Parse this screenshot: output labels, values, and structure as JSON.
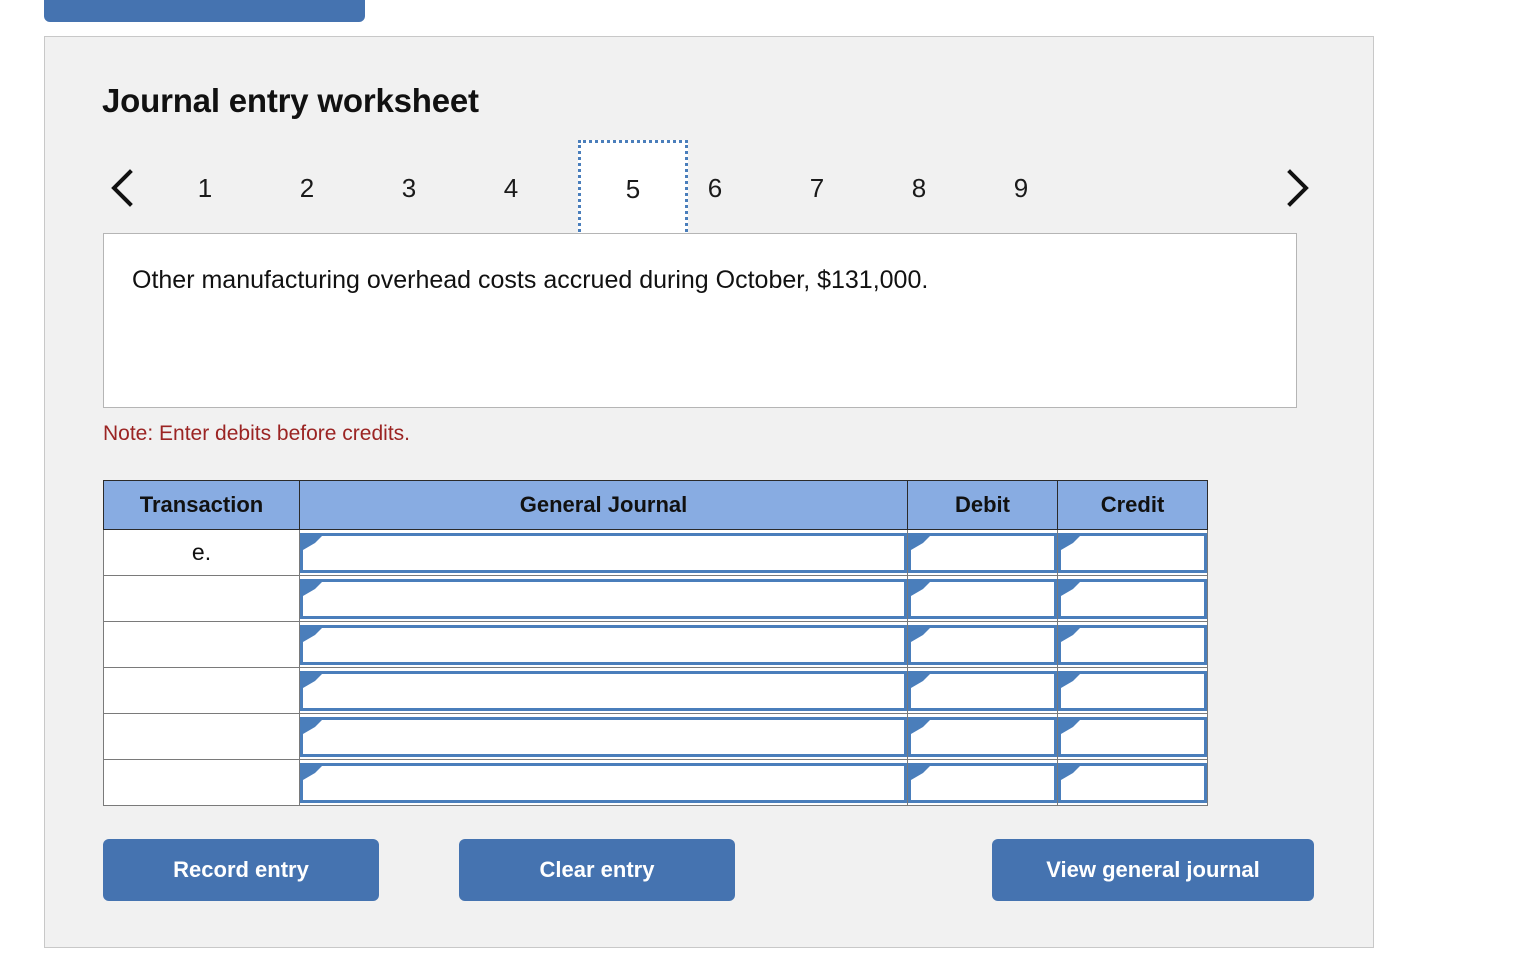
{
  "top_tab": {
    "label": ""
  },
  "panel": {
    "title": "Journal entry worksheet"
  },
  "pager": {
    "prev_icon": "chevron-left-icon",
    "next_icon": "chevron-right-icon",
    "pages": [
      "1",
      "2",
      "3",
      "4",
      "5",
      "6",
      "7",
      "8",
      "9"
    ],
    "active_page": "5"
  },
  "instruction": {
    "text": "Other manufacturing overhead costs accrued during October, $131,000."
  },
  "note": {
    "text": "Note: Enter debits before credits."
  },
  "table": {
    "headers": {
      "transaction": "Transaction",
      "general_journal": "General Journal",
      "debit": "Debit",
      "credit": "Credit"
    },
    "rows": [
      {
        "transaction": "e.",
        "general_journal": "",
        "debit": "",
        "credit": ""
      },
      {
        "transaction": "",
        "general_journal": "",
        "debit": "",
        "credit": ""
      },
      {
        "transaction": "",
        "general_journal": "",
        "debit": "",
        "credit": ""
      },
      {
        "transaction": "",
        "general_journal": "",
        "debit": "",
        "credit": ""
      },
      {
        "transaction": "",
        "general_journal": "",
        "debit": "",
        "credit": ""
      },
      {
        "transaction": "",
        "general_journal": "",
        "debit": "",
        "credit": ""
      }
    ]
  },
  "buttons": {
    "record_entry": "Record entry",
    "clear_entry": "Clear entry",
    "view_general_journal": "View general journal"
  },
  "colors": {
    "button_blue": "#4573B0",
    "header_blue": "#88ACE2",
    "field_border_blue": "#4A7EBB",
    "note_red": "#9B2423",
    "panel_bg": "#F1F1F1"
  }
}
